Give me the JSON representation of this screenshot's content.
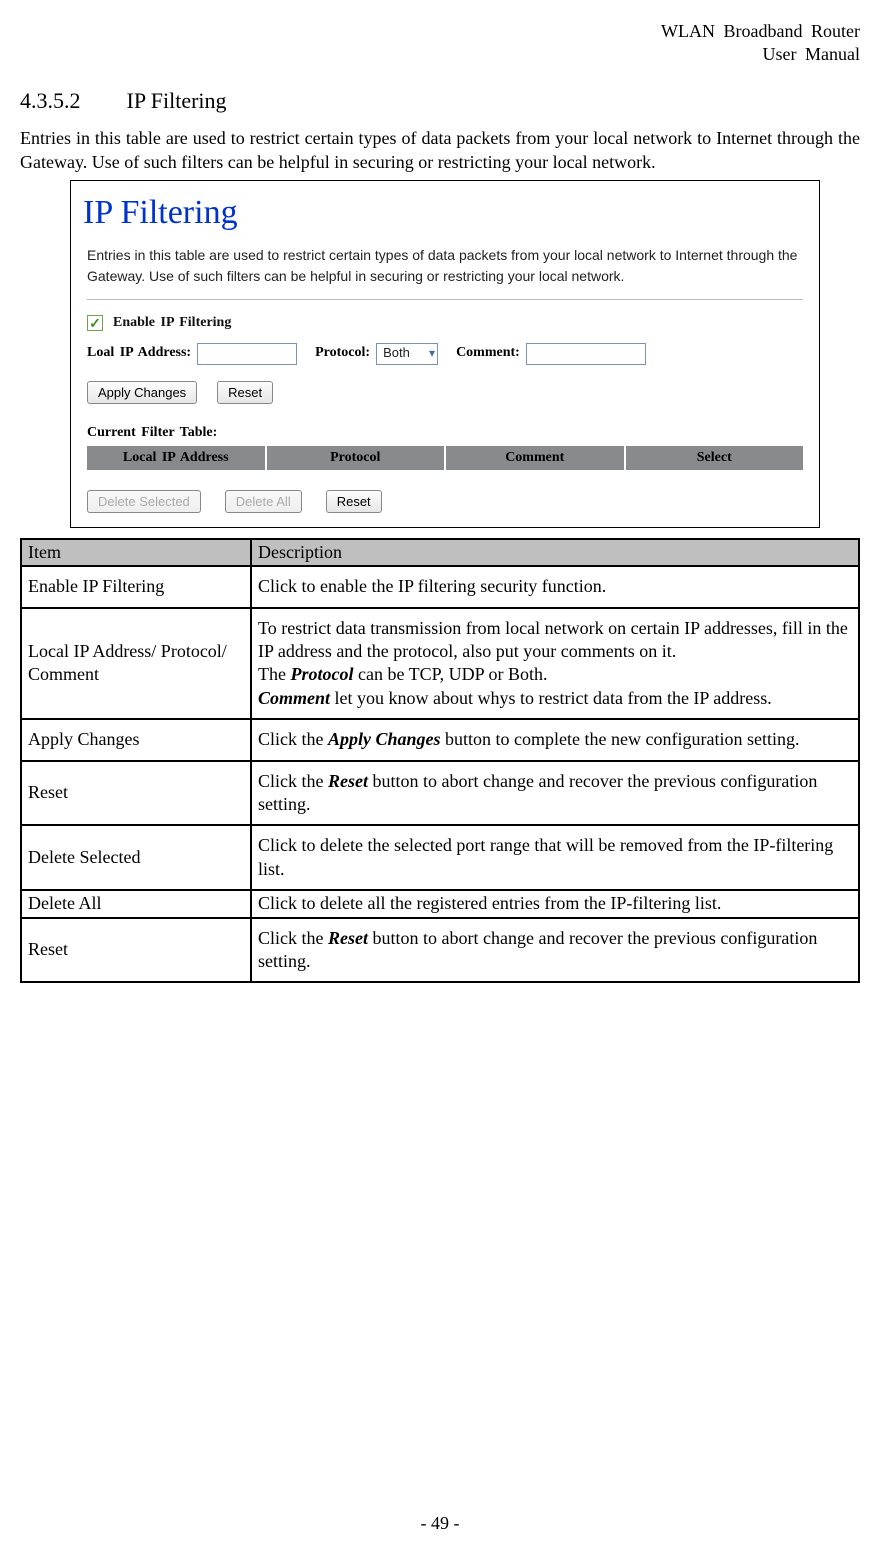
{
  "header": {
    "line1": "WLAN Broadband Router",
    "line2": "User Manual"
  },
  "section": {
    "number": "4.3.5.2",
    "title": "IP Filtering"
  },
  "intro": "Entries in this table are used to restrict certain types of data packets from your local network to Internet through the Gateway. Use of such filters can be helpful in securing or restricting your local network.",
  "screenshot": {
    "title": "IP Filtering",
    "desc": "Entries in this table are used to restrict certain types of data packets from your local network to Internet through the Gateway. Use of such filters can be helpful in securing or restricting your local network.",
    "enable_label": "Enable IP Filtering",
    "fields": {
      "ip_label": "Loal IP Address:",
      "proto_label": "Protocol:",
      "proto_value": "Both",
      "comment_label": "Comment:"
    },
    "buttons": {
      "apply": "Apply Changes",
      "reset": "Reset",
      "delete_selected": "Delete Selected",
      "delete_all": "Delete All",
      "reset2": "Reset"
    },
    "filter_table": {
      "heading": "Current Filter Table:",
      "cols": [
        "Local IP Address",
        "Protocol",
        "Comment",
        "Select"
      ]
    }
  },
  "table": {
    "head": {
      "item": "Item",
      "desc": "Description"
    },
    "rows": [
      {
        "item": "Enable IP Filtering",
        "desc_plain": "Click to enable the IP filtering security function."
      },
      {
        "item": "Local IP Address/ Protocol/ Comment",
        "lines": [
          "To restrict data transmission from local network on certain IP addresses, fill in the IP address and the protocol, also put your comments on it.",
          "The __BI__Protocol__/BI__ can be TCP, UDP or Both.",
          "__BI__Comment__/BI__ let you know about whys to restrict data from the IP address."
        ]
      },
      {
        "item": "Apply Changes",
        "lines": [
          "Click the __BI__Apply Changes__/BI__ button to complete the new configuration setting."
        ]
      },
      {
        "item": "Reset",
        "lines": [
          "Click the __BI__Reset__/BI__ button to abort change and recover the previous configuration setting."
        ]
      },
      {
        "item": "Delete Selected",
        "desc_plain": "Click to delete the selected port range that will be removed from the IP-filtering list."
      },
      {
        "item": "Delete All",
        "desc_plain": "Click to delete all the registered entries from the IP-filtering list.",
        "tight": true
      },
      {
        "item": "Reset",
        "lines": [
          "Click the __BI__Reset__/BI__ button to abort change and recover the previous configuration setting."
        ]
      }
    ]
  },
  "page_number": "- 49 -"
}
